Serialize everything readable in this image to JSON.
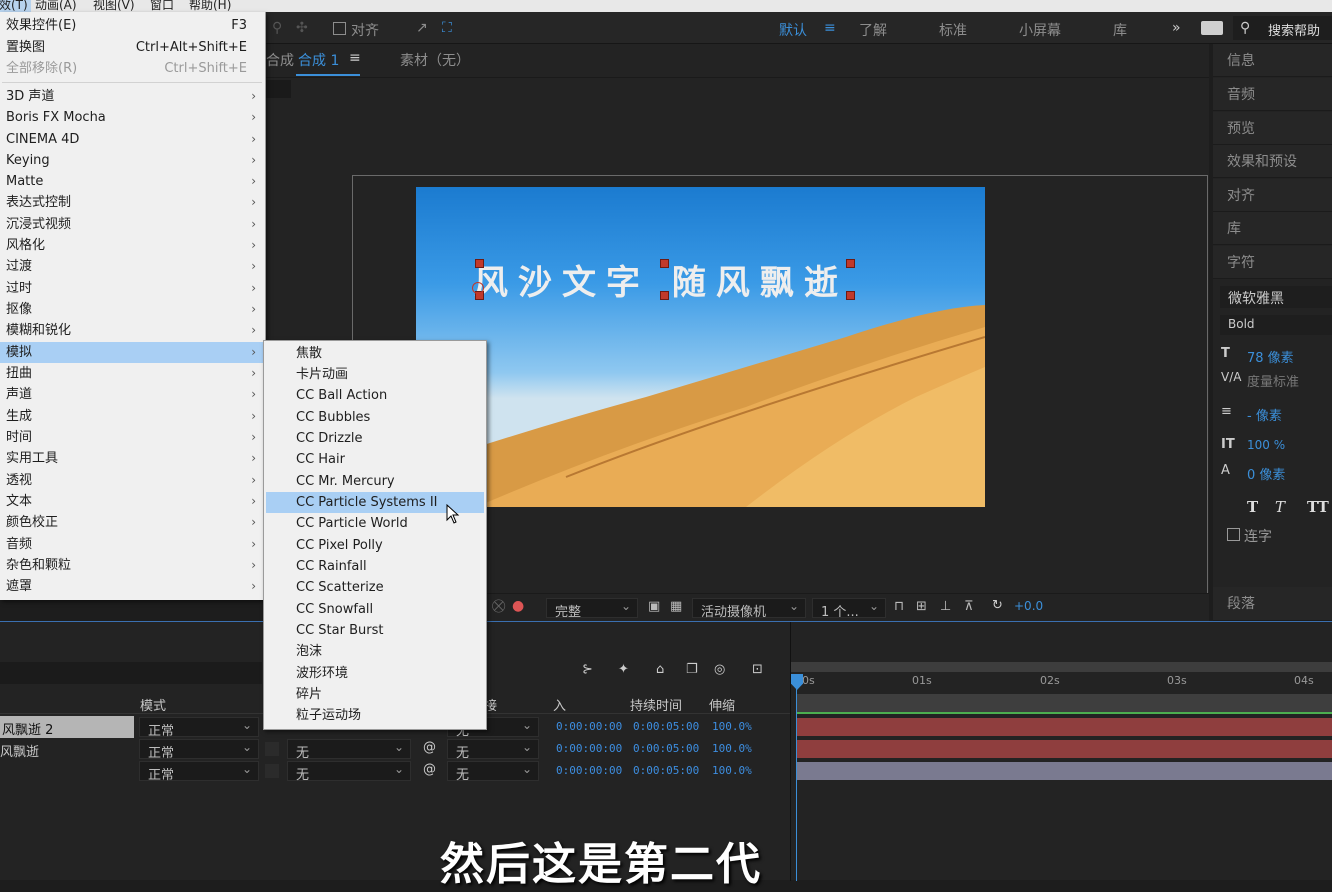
{
  "menubar": {
    "items": [
      "效(T)",
      "动画(A)",
      "视图(V)",
      "窗口",
      "帮助(H)"
    ]
  },
  "toolbar": {
    "align": "对齐",
    "workspaces": [
      "默认",
      "了解",
      "标准",
      "小屏幕",
      "库"
    ],
    "search": "搜索帮助"
  },
  "effect_menu": {
    "items": [
      {
        "label": "效果控件(E)",
        "shortcut": "F3"
      },
      {
        "label": "置换图",
        "shortcut": "Ctrl+Alt+Shift+E"
      },
      {
        "label": "全部移除(R)",
        "shortcut": "Ctrl+Shift+E",
        "disabled": true
      },
      {
        "label": "3D 声道"
      },
      {
        "label": "Boris FX Mocha"
      },
      {
        "label": "CINEMA 4D"
      },
      {
        "label": "Keying"
      },
      {
        "label": "Matte"
      },
      {
        "label": "表达式控制"
      },
      {
        "label": "沉浸式视频"
      },
      {
        "label": "风格化"
      },
      {
        "label": "过渡"
      },
      {
        "label": "过时"
      },
      {
        "label": "抠像"
      },
      {
        "label": "模糊和锐化"
      },
      {
        "label": "模拟"
      },
      {
        "label": "扭曲"
      },
      {
        "label": "声道"
      },
      {
        "label": "生成"
      },
      {
        "label": "时间"
      },
      {
        "label": "实用工具"
      },
      {
        "label": "透视"
      },
      {
        "label": "文本"
      },
      {
        "label": "颜色校正"
      },
      {
        "label": "音频"
      },
      {
        "label": "杂色和颗粒"
      },
      {
        "label": "遮罩"
      }
    ]
  },
  "simulate_submenu": {
    "items": [
      "焦散",
      "卡片动画",
      "CC Ball Action",
      "CC Bubbles",
      "CC Drizzle",
      "CC Hair",
      "CC Mr. Mercury",
      "CC Particle Systems II",
      "CC Particle World",
      "CC Pixel Polly",
      "CC Rainfall",
      "CC Scatterize",
      "CC Snowfall",
      "CC Star Burst",
      "泡沫",
      "波形环境",
      "碎片",
      "粒子运动场"
    ],
    "highlighted": "CC Particle Systems II"
  },
  "comp_panel": {
    "tab_prefix": "合成",
    "tab_active": "合成 1",
    "footage_tab": "素材（无）",
    "canvas_text": "风沙文字 随风飘逝",
    "quality": "完整",
    "camera": "活动摄像机",
    "views": "1 个...",
    "exposure": "+0.0"
  },
  "right_panel": {
    "panels": [
      "信息",
      "音频",
      "预览",
      "效果和预设",
      "对齐",
      "库",
      "字符"
    ],
    "font": "微软雅黑",
    "style": "Bold",
    "size": "78 像素",
    "kerning": "度量标准",
    "leading": "- 像素",
    "vscale": "100 %",
    "baseline": "0 像素",
    "ligatures": "连字",
    "paragraph": "段落"
  },
  "timeline": {
    "headers": {
      "mode": "模式",
      "parent": "接",
      "in": "入",
      "duration": "持续时间",
      "stretch": "伸缩"
    },
    "ruler": [
      "0s",
      "01s",
      "02s",
      "03s",
      "04s"
    ],
    "layers": [
      {
        "name": "风飘逝 2",
        "mode": "正常",
        "matte": "",
        "parent": "无",
        "in": "0:00:00:00",
        "dur": "0:00:05:00",
        "stretch": "100.0%"
      },
      {
        "name": "风飘逝",
        "mode": "正常",
        "matte": "无",
        "parent": "无",
        "in": "0:00:00:00",
        "dur": "0:00:05:00",
        "stretch": "100.0%"
      },
      {
        "name": "",
        "mode": "正常",
        "matte": "无",
        "parent": "无",
        "in": "0:00:00:00",
        "dur": "0:00:05:00",
        "stretch": "100.0%"
      }
    ]
  },
  "subtitle": "然后这是第二代",
  "colors": {
    "accent": "#3b8fd9",
    "highlight": "#a9cff4",
    "layer_red": "#8f3e3e",
    "layer_lavender": "#7a7a90"
  }
}
